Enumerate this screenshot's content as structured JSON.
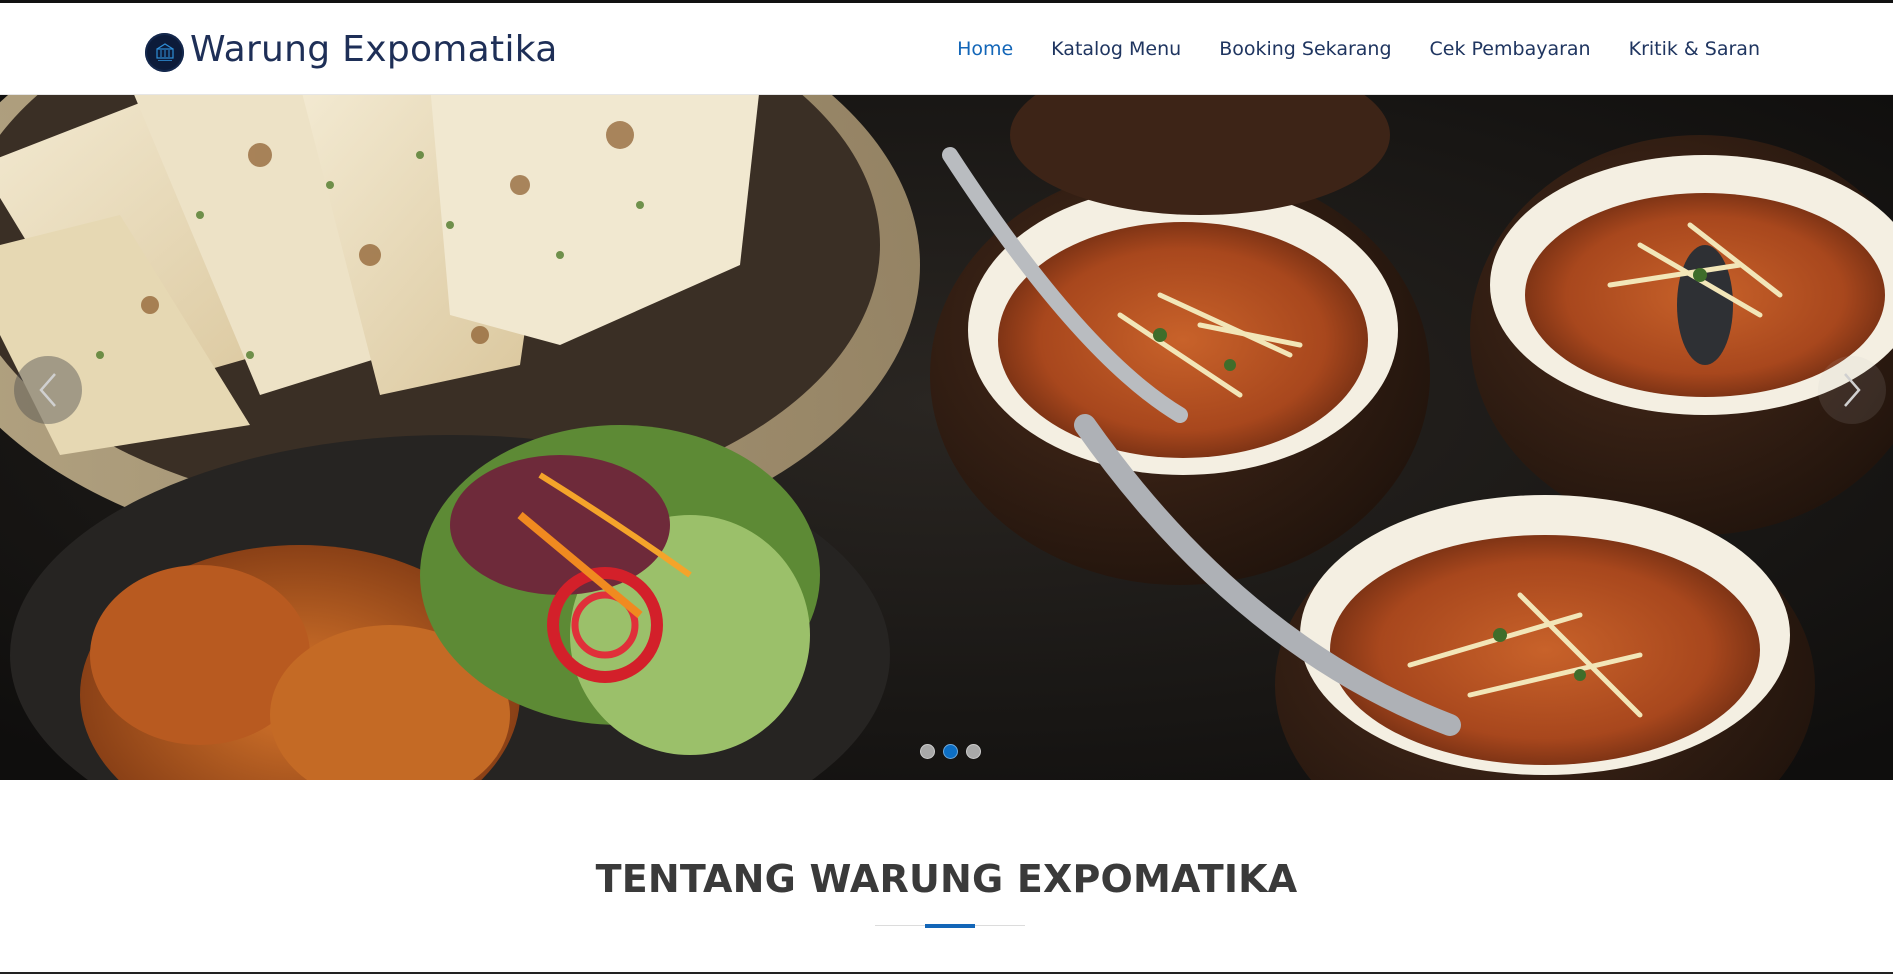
{
  "brand": {
    "name": "Warung Expomatika"
  },
  "nav": {
    "items": [
      {
        "label": "Home",
        "active": true
      },
      {
        "label": "Katalog Menu",
        "active": false
      },
      {
        "label": "Booking Sekarang",
        "active": false
      },
      {
        "label": "Cek Pembayaran",
        "active": false
      },
      {
        "label": "Kritik & Saran",
        "active": false
      }
    ]
  },
  "carousel": {
    "slide_count": 3,
    "active_slide": 2,
    "prev_icon": "chevron-left-icon",
    "next_icon": "chevron-right-icon",
    "image": "food-photo"
  },
  "about": {
    "title": "TENTANG WARUNG EXPOMATIKA"
  },
  "colors": {
    "accent": "#1366b8",
    "brand_text": "#1e2f57",
    "nav_text": "#1f3560",
    "heading": "#3a3a3a"
  }
}
